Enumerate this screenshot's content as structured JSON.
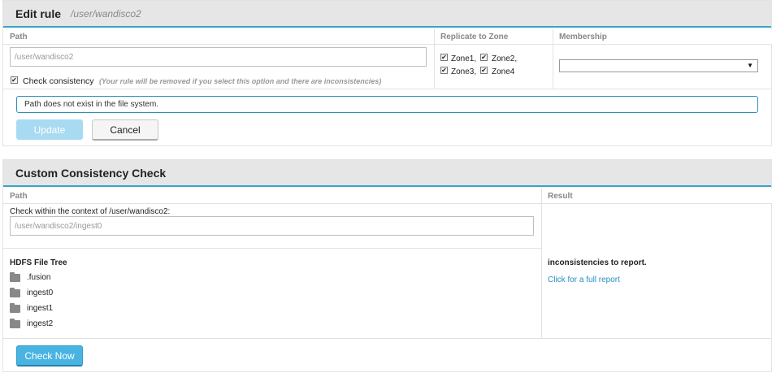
{
  "edit_rule": {
    "title": "Edit rule",
    "path_subtitle": "/user/wandisco2",
    "columns": {
      "path": "Path",
      "replicate": "Replicate to Zone",
      "membership": "Membership"
    },
    "path_input": {
      "value": "/user/wandisco2"
    },
    "check_consistency": {
      "label": "Check consistency",
      "note": "(Your rule will be removed if you select this option and there are inconsistencies)",
      "checked": true
    },
    "zones": [
      {
        "label": "Zone1,",
        "checked": true
      },
      {
        "label": "Zone2,",
        "checked": true
      },
      {
        "label": "Zone3,",
        "checked": true
      },
      {
        "label": "Zone4",
        "checked": true
      }
    ],
    "membership_select": {
      "value": ""
    },
    "alert_message": "Path does not exist in the file system.",
    "update_label": "Update",
    "cancel_label": "Cancel"
  },
  "consistency": {
    "title": "Custom Consistency Check",
    "columns": {
      "path": "Path",
      "result": "Result"
    },
    "context_label": "Check within the context of /user/wandisco2:",
    "path_input": {
      "value": "/user/wandisco2/ingest0"
    },
    "tree": {
      "title": "HDFS File Tree",
      "items": [
        ".fusion",
        "ingest0",
        "ingest1",
        "ingest2"
      ]
    },
    "result_text": "inconsistencies to report.",
    "report_link": "Click for a full report",
    "check_now_label": "Check Now"
  },
  "colors": {
    "accent": "#3aa3c8",
    "primary": "#49b4e2",
    "primary_disabled": "#a8daf2",
    "link": "#2a8fc0"
  }
}
